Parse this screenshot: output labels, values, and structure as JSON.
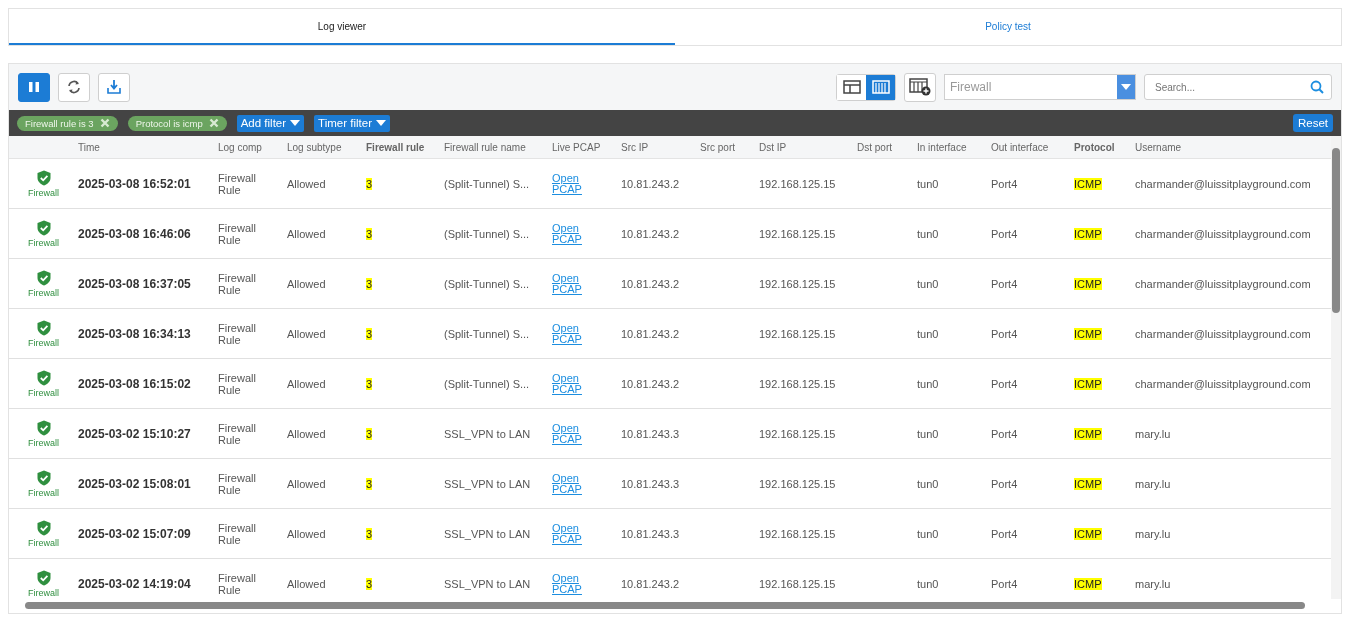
{
  "tabs": [
    {
      "label": "Log viewer",
      "selected": true
    },
    {
      "label": "Policy test",
      "selected": false
    }
  ],
  "toolbar": {
    "paused": true,
    "views": [
      {
        "kind": "split",
        "selected": false
      },
      {
        "kind": "columns",
        "selected": true
      }
    ],
    "log_type": "Firewall",
    "search": {
      "placeholder": "Search..."
    }
  },
  "filters": {
    "active": [
      "Firewall rule is 3",
      "Protocol is icmp"
    ],
    "menus": [
      "Add filter",
      "Timer filter"
    ],
    "reset": "Reset"
  },
  "table": {
    "columns": [
      {
        "label": "Time",
        "highlighted": false
      },
      {
        "label": "Log comp",
        "highlighted": false
      },
      {
        "label": "Log subtype",
        "highlighted": false
      },
      {
        "label": "Firewall rule",
        "highlighted": true
      },
      {
        "label": "Firewall rule name",
        "highlighted": false
      },
      {
        "label": "Live PCAP",
        "highlighted": false
      },
      {
        "label": "Src IP",
        "highlighted": false
      },
      {
        "label": "Src port",
        "highlighted": false
      },
      {
        "label": "Dst IP",
        "highlighted": false
      },
      {
        "label": "Dst port",
        "highlighted": false
      },
      {
        "label": "In interface",
        "highlighted": false
      },
      {
        "label": "Out interface",
        "highlighted": false
      },
      {
        "label": "Protocol",
        "highlighted": true
      },
      {
        "label": "Username",
        "highlighted": false
      }
    ],
    "rows": [
      {
        "icon": "Firewall",
        "time": "2025-03-08 16:52:01",
        "log_comp": "Firewall Rule",
        "subtype": "Allowed",
        "rule": "3",
        "rule_name": "(Split-Tunnel) S...",
        "pcap": "Open PCAP",
        "src_ip": "10.81.243.2",
        "dst_ip": "192.168.125.15",
        "in_if": "tun0",
        "out_if": "Port4",
        "protocol": "ICMP",
        "username": "charmander@luissitplayground.com"
      },
      {
        "icon": "Firewall",
        "time": "2025-03-08 16:46:06",
        "log_comp": "Firewall Rule",
        "subtype": "Allowed",
        "rule": "3",
        "rule_name": "(Split-Tunnel) S...",
        "pcap": "Open PCAP",
        "src_ip": "10.81.243.2",
        "dst_ip": "192.168.125.15",
        "in_if": "tun0",
        "out_if": "Port4",
        "protocol": "ICMP",
        "username": "charmander@luissitplayground.com"
      },
      {
        "icon": "Firewall",
        "time": "2025-03-08 16:37:05",
        "log_comp": "Firewall Rule",
        "subtype": "Allowed",
        "rule": "3",
        "rule_name": "(Split-Tunnel) S...",
        "pcap": "Open PCAP",
        "src_ip": "10.81.243.2",
        "dst_ip": "192.168.125.15",
        "in_if": "tun0",
        "out_if": "Port4",
        "protocol": "ICMP",
        "username": "charmander@luissitplayground.com"
      },
      {
        "icon": "Firewall",
        "time": "2025-03-08 16:34:13",
        "log_comp": "Firewall Rule",
        "subtype": "Allowed",
        "rule": "3",
        "rule_name": "(Split-Tunnel) S...",
        "pcap": "Open PCAP",
        "src_ip": "10.81.243.2",
        "dst_ip": "192.168.125.15",
        "in_if": "tun0",
        "out_if": "Port4",
        "protocol": "ICMP",
        "username": "charmander@luissitplayground.com"
      },
      {
        "icon": "Firewall",
        "time": "2025-03-08 16:15:02",
        "log_comp": "Firewall Rule",
        "subtype": "Allowed",
        "rule": "3",
        "rule_name": "(Split-Tunnel) S...",
        "pcap": "Open PCAP",
        "src_ip": "10.81.243.2",
        "dst_ip": "192.168.125.15",
        "in_if": "tun0",
        "out_if": "Port4",
        "protocol": "ICMP",
        "username": "charmander@luissitplayground.com"
      },
      {
        "icon": "Firewall",
        "time": "2025-03-02 15:10:27",
        "log_comp": "Firewall Rule",
        "subtype": "Allowed",
        "rule": "3",
        "rule_name": "SSL_VPN to LAN",
        "pcap": "Open PCAP",
        "src_ip": "10.81.243.3",
        "dst_ip": "192.168.125.15",
        "in_if": "tun0",
        "out_if": "Port4",
        "protocol": "ICMP",
        "username": "mary.lu"
      },
      {
        "icon": "Firewall",
        "time": "2025-03-02 15:08:01",
        "log_comp": "Firewall Rule",
        "subtype": "Allowed",
        "rule": "3",
        "rule_name": "SSL_VPN to LAN",
        "pcap": "Open PCAP",
        "src_ip": "10.81.243.3",
        "dst_ip": "192.168.125.15",
        "in_if": "tun0",
        "out_if": "Port4",
        "protocol": "ICMP",
        "username": "mary.lu"
      },
      {
        "icon": "Firewall",
        "time": "2025-03-02 15:07:09",
        "log_comp": "Firewall Rule",
        "subtype": "Allowed",
        "rule": "3",
        "rule_name": "SSL_VPN to LAN",
        "pcap": "Open PCAP",
        "src_ip": "10.81.243.3",
        "dst_ip": "192.168.125.15",
        "in_if": "tun0",
        "out_if": "Port4",
        "protocol": "ICMP",
        "username": "mary.lu"
      },
      {
        "icon": "Firewall",
        "time": "2025-03-02 14:19:04",
        "log_comp": "Firewall Rule",
        "subtype": "Allowed",
        "rule": "3",
        "rule_name": "SSL_VPN to LAN",
        "pcap": "Open PCAP",
        "src_ip": "10.81.243.2",
        "dst_ip": "192.168.125.15",
        "in_if": "tun0",
        "out_if": "Port4",
        "protocol": "ICMP",
        "username": "mary.lu"
      }
    ]
  }
}
